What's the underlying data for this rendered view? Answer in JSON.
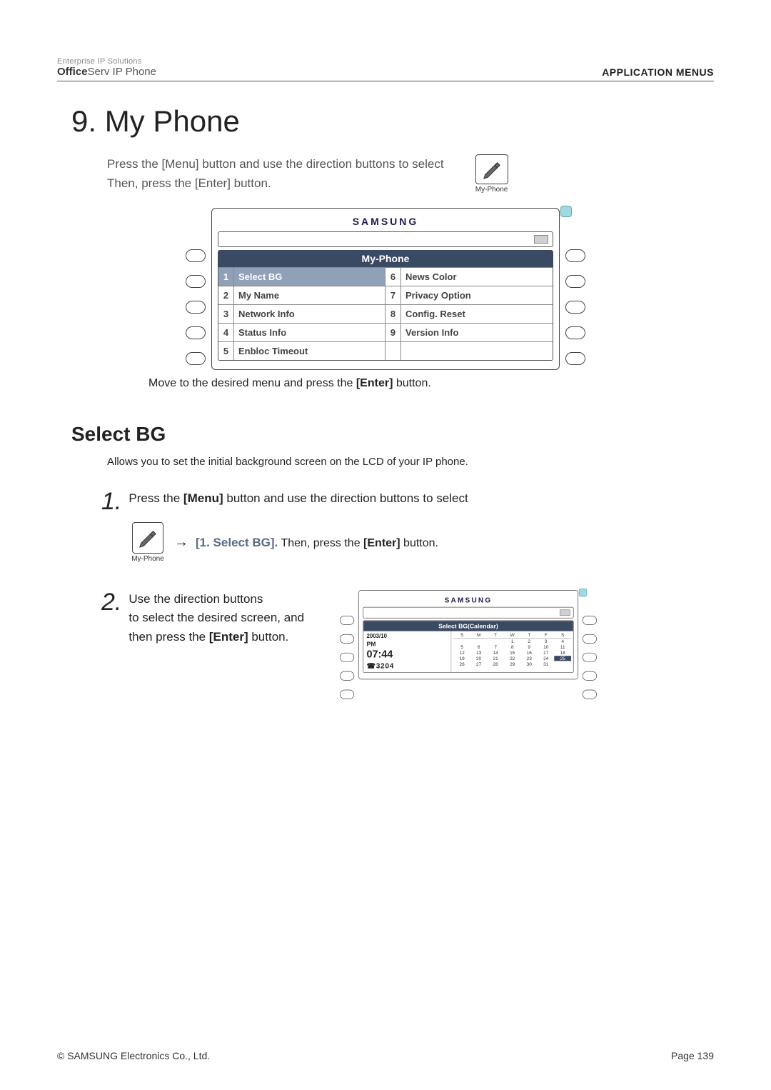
{
  "header": {
    "brand_tag": "Enterprise IP Solutions",
    "brand_bold": "Office",
    "brand_rest": "Serv IP Phone",
    "section": "APPLICATION  MENUS"
  },
  "h1": "9. My Phone",
  "intro_line1": "Press the [Menu] button and use the direction buttons to select",
  "intro_line2": "Then, press the [Enter] button.",
  "icon_label": "My-Phone",
  "device": {
    "brand": "SAMSUNG",
    "title": "My-Phone",
    "menu": {
      "1": "Select BG",
      "2": "My Name",
      "3": "Network Info",
      "4": "Status Info",
      "5": "Enbloc Timeout",
      "6": "News Color",
      "7": "Privacy Option",
      "8": "Config. Reset",
      "9": "Version Info"
    }
  },
  "note_prefix": "Move to the desired menu and press the ",
  "note_bold": "[Enter]",
  "note_suffix": " button.",
  "h2": "Select BG",
  "select_bg_desc": "Allows you to set the initial background screen on the LCD of your IP phone.",
  "step1_num": "1",
  "step1_text_prefix": "Press the ",
  "step1_text_bold": "[Menu]",
  "step1_text_suffix": " button and use the direction buttons to select",
  "arrow": "→",
  "select_bg_bold": "[1. Select BG].",
  "then_press_prefix": "  Then, press the ",
  "then_press_bold": "[Enter]",
  "then_press_suffix": " button.",
  "step2_num": "2",
  "step2_line1": "Use the direction buttons",
  "step2_line2": "to select the desired screen, and",
  "step2_line3_prefix": "then press the ",
  "step2_line3_bold": "[Enter]",
  "step2_line3_suffix": " button.",
  "mini": {
    "title": "Select BG(Calendar)",
    "year_month": "2003/10",
    "pm": "PM",
    "time": "07:44",
    "ext": "☎3204",
    "dow": [
      "S",
      "M",
      "T",
      "W",
      "T",
      "F",
      "S"
    ],
    "cells": [
      "",
      "",
      "",
      "1",
      "2",
      "3",
      "4",
      "5",
      "6",
      "7",
      "8",
      "9",
      "10",
      "11",
      "12",
      "13",
      "14",
      "15",
      "16",
      "17",
      "18",
      "19",
      "20",
      "21",
      "22",
      "23",
      "24",
      "25",
      "26",
      "27",
      "28",
      "29",
      "30",
      "31",
      ""
    ],
    "highlight_index": 27
  },
  "footer": {
    "copyright": "© SAMSUNG Electronics Co., Ltd.",
    "page": "Page 139"
  }
}
